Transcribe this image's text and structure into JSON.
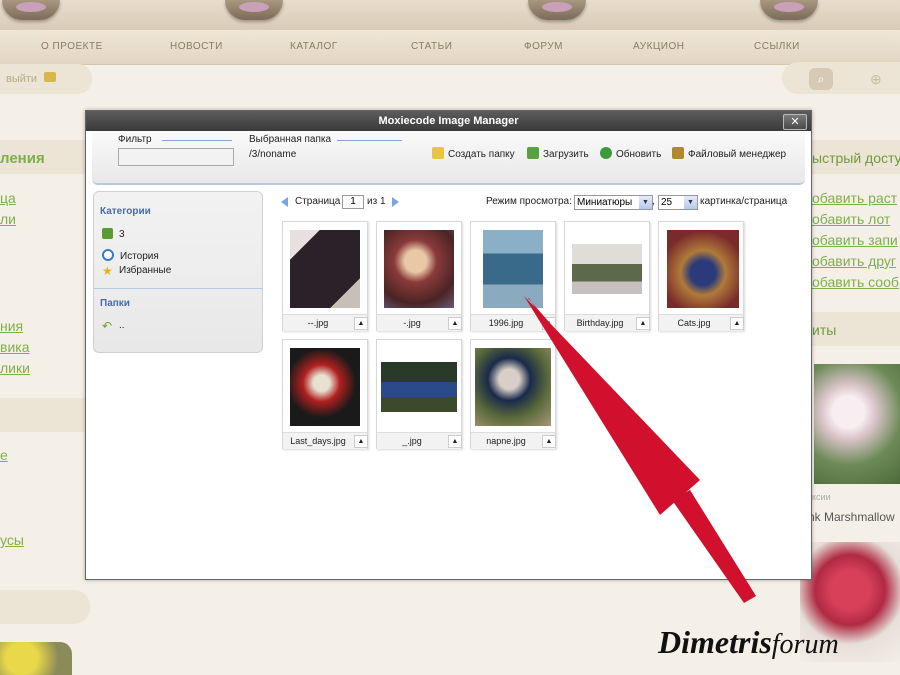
{
  "site": {
    "nav": [
      "О ПРОЕКТЕ",
      "НОВОСТИ",
      "КАТАЛОГ",
      "СТАТЬИ",
      "ФОРУМ",
      "АУКЦИОН",
      "ССЫЛКИ"
    ],
    "exit_label": "выйти",
    "left_fragments": [
      "ления",
      "ца",
      "ли",
      "ния",
      "вика",
      "лики",
      "е",
      "усы"
    ],
    "right_heading": "ыстрый досту",
    "right_links": [
      "обавить раст",
      "обавить лот",
      "обавить запи",
      "обавить друг",
      "обавить сооб"
    ],
    "right_heading2": "иты",
    "caption_small": "ксии",
    "caption_name": "nk Marshmallow"
  },
  "dialog": {
    "title": "Moxiecode Image Manager",
    "close_symbol": "✕",
    "filter_label": "Фильтр",
    "filter_value": "",
    "folder_label": "Выбранная папка",
    "folder_value": "/3/noname",
    "buttons": [
      "Создать папку",
      "Загрузить",
      "Обновить",
      "Файловый менеджер"
    ]
  },
  "sidebar": {
    "categories_title": "Категории",
    "categories": [
      "3",
      "История",
      "Избранные"
    ],
    "folders_title": "Папки",
    "folders": [
      ".."
    ]
  },
  "paging": {
    "page_label": "Страница",
    "page": "1",
    "of_label": "из 1",
    "view_label": "Режим просмотра:",
    "view_value": "Миниатюры",
    "per_page": "25",
    "per_page_label": "картинка/страница"
  },
  "thumbnails": [
    {
      "name": "--.jpg"
    },
    {
      "name": "-.jpg"
    },
    {
      "name": "1996.jpg"
    },
    {
      "name": "Birthday.jpg"
    },
    {
      "name": "Cats.jpg"
    },
    {
      "name": "Last_days.jpg"
    },
    {
      "name": "_.jpg"
    },
    {
      "name": "napne.jpg"
    }
  ],
  "thumb_menu_symbol": "▲",
  "watermark": {
    "main": "Dimetris",
    "sub": "forum"
  },
  "colors": {
    "accent_arrow": "#d0102c",
    "link_green": "#7fae4c",
    "titlebar": "#444444"
  }
}
